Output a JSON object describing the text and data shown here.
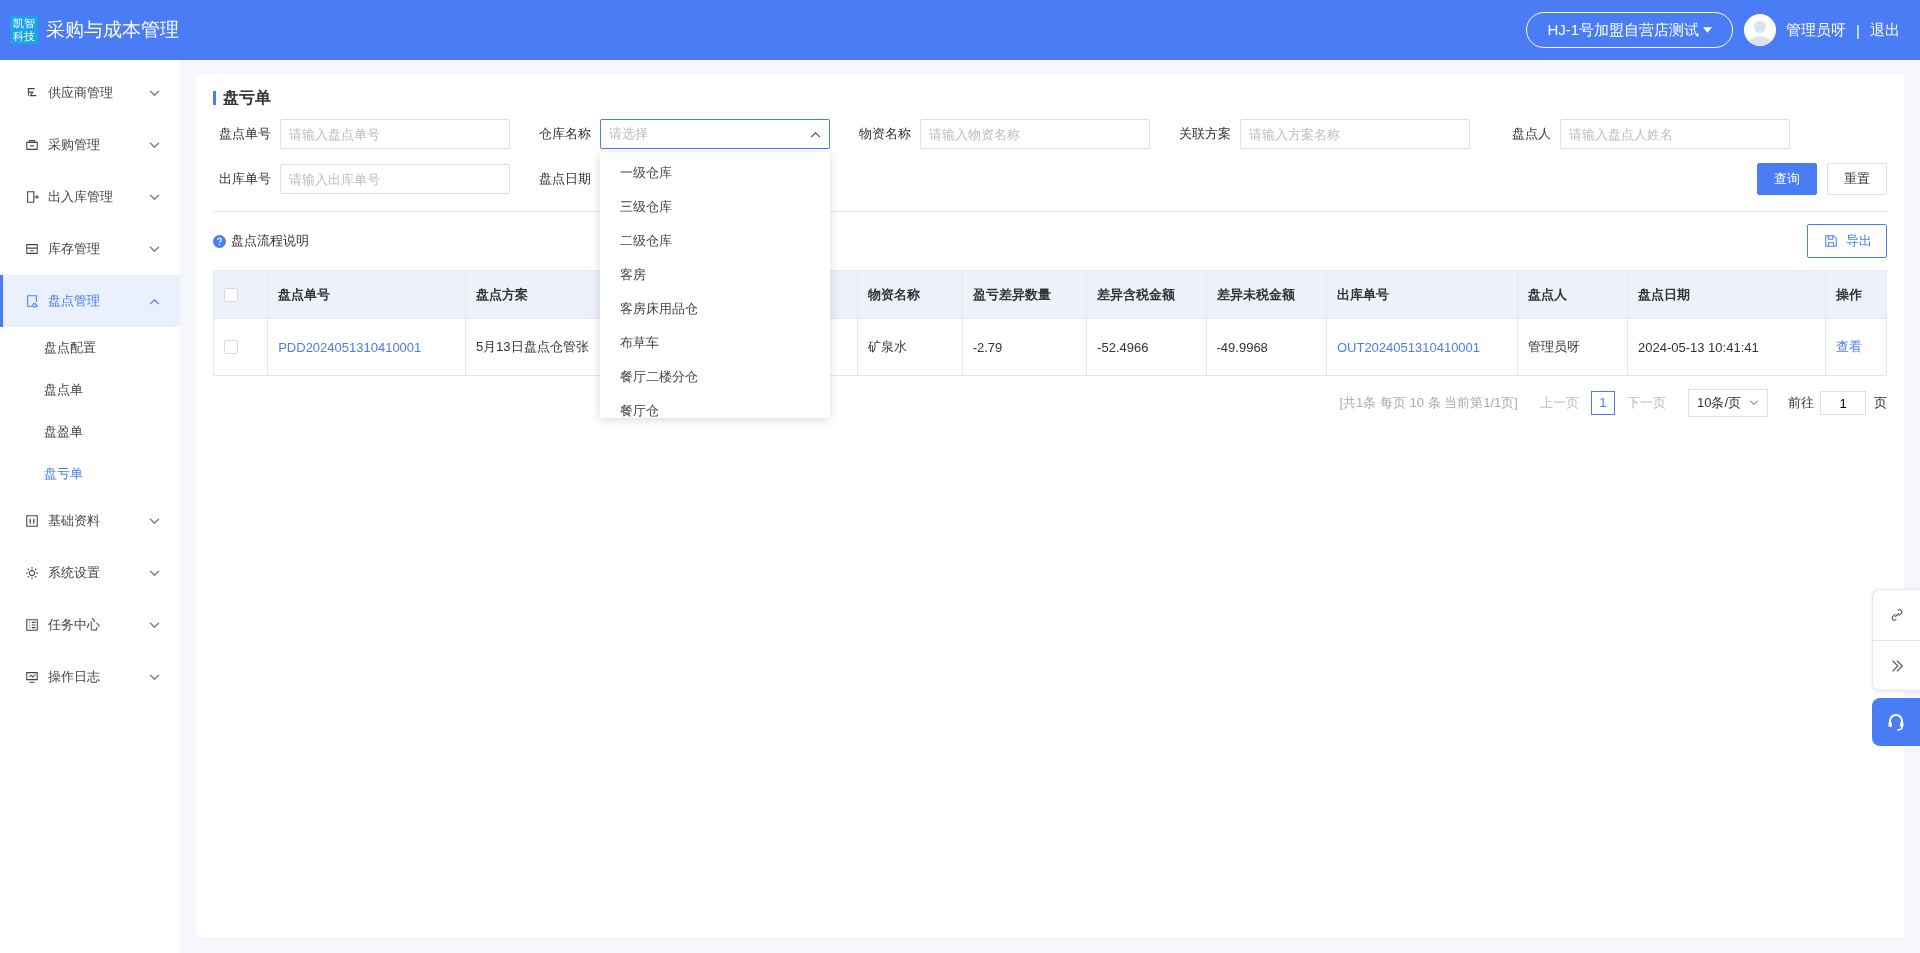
{
  "header": {
    "logo_text": "凯智科技",
    "app_title": "采购与成本管理",
    "store_selector": "HJ-1号加盟自营店测试",
    "user_name": "管理员呀",
    "separator": "|",
    "logout": "退出"
  },
  "sidebar": {
    "items": [
      {
        "label": "供应商管理",
        "expanded": false,
        "selected": false
      },
      {
        "label": "采购管理",
        "expanded": false,
        "selected": false
      },
      {
        "label": "出入库管理",
        "expanded": false,
        "selected": false
      },
      {
        "label": "库存管理",
        "expanded": false,
        "selected": false
      },
      {
        "label": "盘点管理",
        "expanded": true,
        "selected": true,
        "children": [
          {
            "label": "盘点配置",
            "selected": false
          },
          {
            "label": "盘点单",
            "selected": false
          },
          {
            "label": "盘盈单",
            "selected": false
          },
          {
            "label": "盘亏单",
            "selected": true
          }
        ]
      },
      {
        "label": "基础资料",
        "expanded": false,
        "selected": false
      },
      {
        "label": "系统设置",
        "expanded": false,
        "selected": false
      },
      {
        "label": "任务中心",
        "expanded": false,
        "selected": false
      },
      {
        "label": "操作日志",
        "expanded": false,
        "selected": false
      }
    ]
  },
  "page": {
    "title": "盘亏单",
    "filters_row1": [
      {
        "label": "盘点单号",
        "kind": "input",
        "placeholder": "请输入盘点单号"
      },
      {
        "label": "仓库名称",
        "kind": "select",
        "placeholder": "请选择",
        "expanded": true,
        "options": [
          "一级仓库",
          "三级仓库",
          "二级仓库",
          "客房",
          "客房床用品仓",
          "布草车",
          "餐厅二楼分仓",
          "餐厅仓"
        ]
      },
      {
        "label": "物资名称",
        "kind": "input",
        "placeholder": "请输入物资名称"
      },
      {
        "label": "关联方案",
        "kind": "input",
        "placeholder": "请输入方案名称"
      },
      {
        "label": "盘点人",
        "kind": "input",
        "placeholder": "请输入盘点人姓名"
      }
    ],
    "filters_row2": [
      {
        "label": "出库单号",
        "kind": "input",
        "placeholder": "请输入出库单号"
      },
      {
        "label": "盘点日期",
        "kind": "label"
      }
    ],
    "buttons": [
      {
        "label": "查询",
        "kind": "primary"
      },
      {
        "label": "重置",
        "kind": "default"
      }
    ],
    "help_link": "盘点流程说明",
    "export_button": "导出",
    "table": {
      "header_checked": false,
      "columns": [
        "盘点单号",
        "盘点方案",
        "物资名称",
        "盈亏差异数量",
        "差异含税金额",
        "差异未税金额",
        "出库单号",
        "盘点人",
        "盘点日期",
        "操作"
      ],
      "rows": [
        {
          "checked": false,
          "cells": [
            {
              "text": "PDD2024051310410001",
              "kind": "link"
            },
            {
              "text": "5月13日盘点仓管张",
              "kind": "text"
            },
            {
              "text": "矿泉水",
              "kind": "text"
            },
            {
              "text": "-2.79",
              "kind": "text"
            },
            {
              "text": "-52.4966",
              "kind": "text"
            },
            {
              "text": "-49.9968",
              "kind": "text"
            },
            {
              "text": "OUT2024051310410001",
              "kind": "link"
            },
            {
              "text": "管理员呀",
              "kind": "text"
            },
            {
              "text": "2024-05-13 10:41:41",
              "kind": "text"
            },
            {
              "text": "查看",
              "kind": "link"
            }
          ]
        }
      ]
    }
  },
  "pagination": {
    "summary": "[共1条 每页 10 条 当前第1/1页]",
    "prev": {
      "label": "上一页",
      "disabled": true
    },
    "pages": [
      {
        "label": "1",
        "selected": true
      }
    ],
    "next": {
      "label": "下一页",
      "disabled": true
    },
    "page_size": "10条/页",
    "goto_label": "前往",
    "goto_value": "1",
    "goto_suffix": "页"
  }
}
